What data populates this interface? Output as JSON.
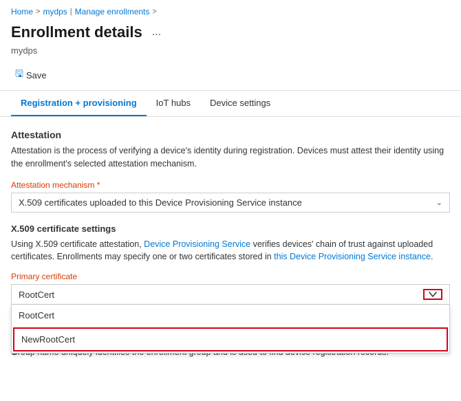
{
  "breadcrumb": {
    "home": "Home",
    "sep1": ">",
    "mydps": "mydps",
    "pipe": "|",
    "manage": "Manage enrollments",
    "sep2": ">"
  },
  "header": {
    "title": "Enrollment details",
    "ellipsis": "...",
    "subtitle": "mydps"
  },
  "toolbar": {
    "save_label": "Save"
  },
  "tabs": [
    {
      "id": "tab-reg",
      "label": "Registration + provisioning",
      "active": true
    },
    {
      "id": "tab-iot",
      "label": "IoT hubs",
      "active": false
    },
    {
      "id": "tab-device",
      "label": "Device settings",
      "active": false
    }
  ],
  "attestation": {
    "section_title": "Attestation",
    "desc": "Attestation is the process of verifying a device's identity during registration. Devices must attest their identity using the enrollment's selected attestation mechanism.",
    "mechanism_label": "Attestation mechanism",
    "mechanism_required": "*",
    "mechanism_value": "X.509 certificates uploaded to this Device Provisioning Service instance",
    "x509": {
      "title": "X.509 certificate settings",
      "desc": "Using X.509 certificate attestation, Device Provisioning Service verifies devices' chain of trust against uploaded certificates. Enrollments may specify one or two certificates stored in this Device Provisioning Service instance.",
      "primary_cert_label": "Primary certificate",
      "primary_cert_value": "RootCert",
      "dropdown_items": [
        {
          "id": "item-rootcert",
          "label": "RootCert",
          "selected": false
        },
        {
          "id": "item-newrootcert",
          "label": "NewRootCert",
          "highlighted": true
        }
      ]
    }
  },
  "group_name": {
    "G_letter": "G",
    "desc": "roup name uniquely identifies the enrollment group and is used to find device registration records."
  }
}
